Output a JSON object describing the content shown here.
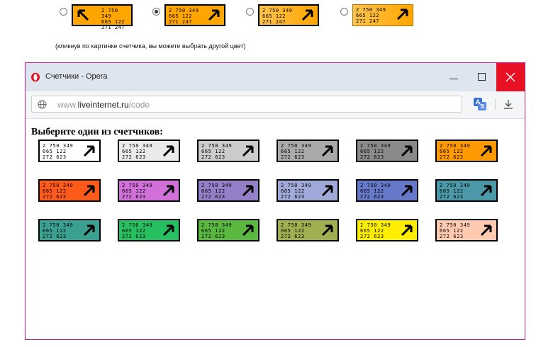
{
  "style_chooser": {
    "options": [
      {
        "selected": false,
        "arrow": "up-left",
        "digits": [
          "2 750 349",
          "665 122",
          "271 247"
        ]
      },
      {
        "selected": true,
        "arrow": "up-right",
        "digits": [
          "2 750 349",
          "665 122",
          "271 247"
        ]
      },
      {
        "selected": false,
        "arrow": "up-right",
        "digits": [
          "2 750 349",
          "665 122",
          "271 247"
        ]
      },
      {
        "selected": false,
        "arrow": "up-right",
        "digits": [
          "2 750 349",
          "665 122",
          "271 247"
        ]
      }
    ],
    "color": "#ffa500",
    "hint": "(кликнув по картинке счетчика, вы можете выбрать другой цвет)"
  },
  "window": {
    "title": "Счетчики - Opera",
    "url_prefix": "www.",
    "url_host": "liveinternet.ru",
    "url_path": "/code",
    "controls": {
      "minimize": "minimize-icon",
      "maximize": "maximize-icon",
      "close": "close-icon"
    }
  },
  "page": {
    "heading": "Выберите один из счетчиков:",
    "counter_digits": [
      "2 750 349",
      "665 122",
      "272 623"
    ],
    "counters": [
      {
        "color": "#ffffff"
      },
      {
        "color": "#ebebeb"
      },
      {
        "color": "#cccccc"
      },
      {
        "color": "#aaaaaa"
      },
      {
        "color": "#8a8a8a"
      },
      {
        "color": "#ff9900"
      },
      {
        "color": "#ff5a1a"
      },
      {
        "color": "#d070d8"
      },
      {
        "color": "#9480c8"
      },
      {
        "color": "#a0aad8"
      },
      {
        "color": "#6678c8"
      },
      {
        "color": "#4a98a8"
      },
      {
        "color": "#3aa090"
      },
      {
        "color": "#26c060"
      },
      {
        "color": "#5ab840"
      },
      {
        "color": "#a0b050"
      },
      {
        "color": "#ffee00"
      },
      {
        "color": "#ffcab0"
      }
    ]
  }
}
